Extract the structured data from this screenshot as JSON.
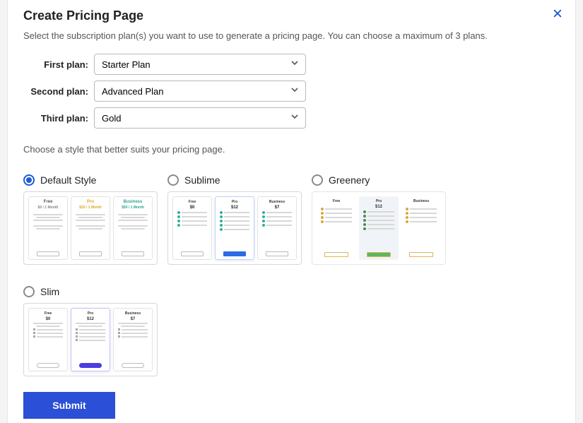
{
  "title": "Create Pricing Page",
  "subtitle": "Select the subscription plan(s) you want to use to generate a pricing page. You can choose a maximum of 3 plans.",
  "plans": {
    "first": {
      "label": "First plan:",
      "value": "Starter Plan"
    },
    "second": {
      "label": "Second plan:",
      "value": "Advanced Plan"
    },
    "third": {
      "label": "Third plan:",
      "value": "Gold"
    }
  },
  "style_note": "Choose a style that better suits your pricing page.",
  "styles": {
    "default": {
      "label": "Default Style",
      "selected": true
    },
    "sublime": {
      "label": "Sublime",
      "selected": false
    },
    "greenery": {
      "label": "Greenery",
      "selected": false
    },
    "slim": {
      "label": "Slim",
      "selected": false
    }
  },
  "thumb_labels": {
    "free": "Free",
    "pro": "Pro",
    "business": "Business",
    "price_free": "$0 / 1 Month",
    "price_pro": "$25 / 1 Month",
    "price_biz": "$50 / 1 Month",
    "sublime_free": "Free",
    "sublime_pro": "Pro",
    "sublime_biz": "Business",
    "sublime_p0": "$0",
    "sublime_p12": "$12",
    "sublime_p37": "$7",
    "slim_free": "Free",
    "slim_pro": "Pro",
    "slim_biz": "Business",
    "slim_p0": "$0",
    "slim_p12": "$12",
    "slim_p37": "$7"
  },
  "submit": "Submit",
  "colors": {
    "primary": "#2b4fd6",
    "accent_blue": "#2b6be4",
    "accent_green": "#5db65c",
    "accent_indigo": "#4a3ee0"
  }
}
